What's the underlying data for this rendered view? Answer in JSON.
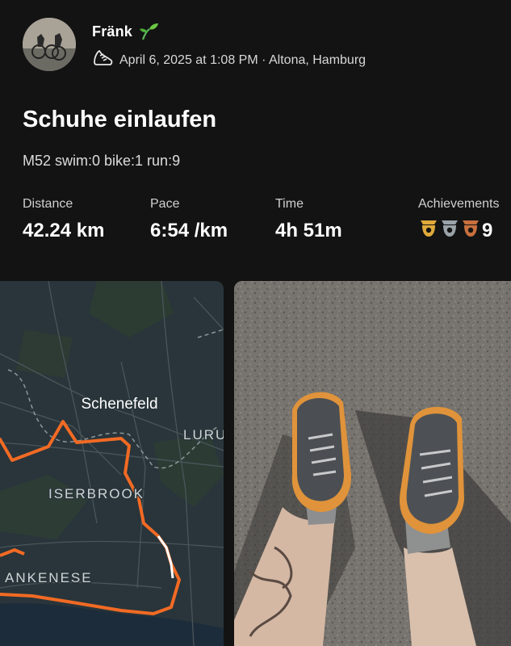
{
  "athlete": {
    "name": "Fränk",
    "badge_icon": "sprout-icon",
    "activity_icon": "running-shoe-icon",
    "date_location": "April 6, 2025 at 1:08 PM · Altona, Hamburg"
  },
  "activity": {
    "title": "Schuhe einlaufen",
    "description": "M52 swim:0 bike:1 run:9"
  },
  "stats": {
    "distance": {
      "label": "Distance",
      "value": "42.24 km"
    },
    "pace": {
      "label": "Pace",
      "value": "6:54 /km"
    },
    "time": {
      "label": "Time",
      "value": "4h 51m"
    },
    "achievements": {
      "label": "Achievements",
      "count": "9",
      "medals": [
        {
          "icon": "gold-trophy-icon",
          "color": "#e0a93a"
        },
        {
          "icon": "silver-trophy-icon",
          "color": "#9aa3a8"
        },
        {
          "icon": "bronze-trophy-icon",
          "color": "#c8703e"
        }
      ]
    }
  },
  "map": {
    "labels": {
      "schenefeld": "Schenefeld",
      "lurup": "LURU",
      "iserbrook": "ISERBROOK",
      "blankenese": "ANKENESE"
    },
    "route_color": "#f26a24",
    "water_color": "#1d2c3a"
  },
  "colors": {
    "background": "#131313",
    "text_primary": "#ffffff",
    "text_secondary": "#d8d8d8"
  }
}
